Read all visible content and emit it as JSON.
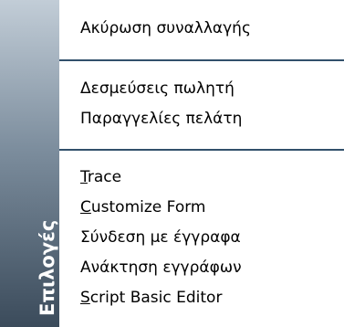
{
  "sidebar": {
    "label": "Επιλογές"
  },
  "menu": {
    "groups": [
      {
        "items": [
          {
            "label": "Ακύρωση συναλλαγής"
          }
        ]
      },
      {
        "items": [
          {
            "label": "Δεσμεύσεις πωλητή"
          },
          {
            "label": "Παραγγελίες πελάτη"
          }
        ]
      },
      {
        "items": [
          {
            "mnemonic": "T",
            "rest": "race"
          },
          {
            "mnemonic": "C",
            "rest": "ustomize Form"
          },
          {
            "label": "Σύνδεση με έγγραφα"
          },
          {
            "label": "Ανάκτηση εγγράφων"
          },
          {
            "mnemonic": "S",
            "rest": "cript Basic Editor"
          }
        ]
      }
    ]
  },
  "colors": {
    "separator": "#32506b",
    "strip_top": "#c2cdd7",
    "strip_bottom": "#3b4b5b"
  }
}
